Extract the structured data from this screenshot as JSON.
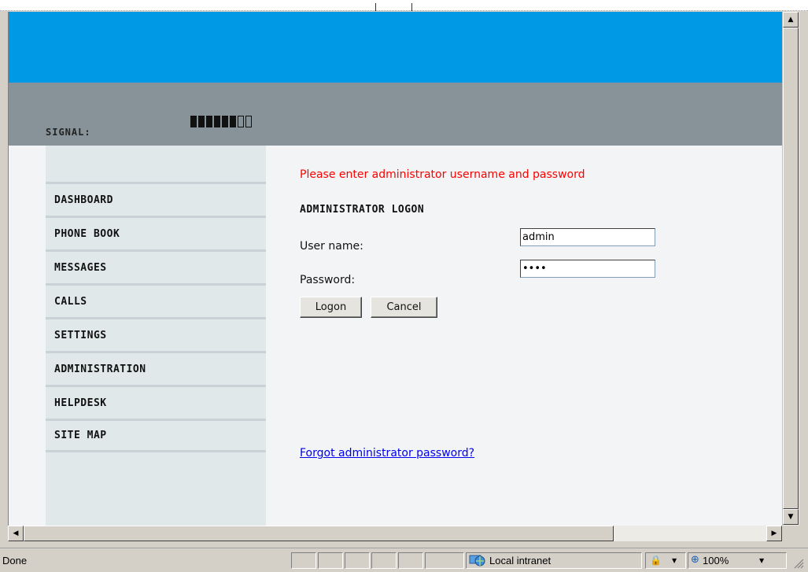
{
  "header": {
    "signal_label": "SIGNAL:",
    "signal_bars_filled": 6,
    "signal_bars_total": 8,
    "banner_color": "#0099e6",
    "band_color": "#889399"
  },
  "sidebar": {
    "items": [
      {
        "label": "DASHBOARD"
      },
      {
        "label": "PHONE BOOK"
      },
      {
        "label": "MESSAGES"
      },
      {
        "label": "CALLS"
      },
      {
        "label": "SETTINGS"
      },
      {
        "label": "ADMINISTRATION"
      },
      {
        "label": "HELPDESK"
      },
      {
        "label": "SITE MAP"
      }
    ]
  },
  "main": {
    "prompt": "Please enter administrator username and password",
    "heading": "ADMINISTRATOR LOGON",
    "username_label": "User name:",
    "username_value": "admin",
    "password_label": "Password:",
    "password_value": "••••",
    "logon_button": "Logon",
    "cancel_button": "Cancel",
    "forgot_link": "Forgot administrator password?",
    "prompt_color": "#ff0000",
    "link_color": "#0000ee"
  },
  "statusbar": {
    "status": "Done",
    "zone": "Local intranet",
    "zoom": "100%",
    "icons": [
      "globe-icon",
      "lock-icon",
      "zoom-icon",
      "resize-grip-icon"
    ]
  }
}
